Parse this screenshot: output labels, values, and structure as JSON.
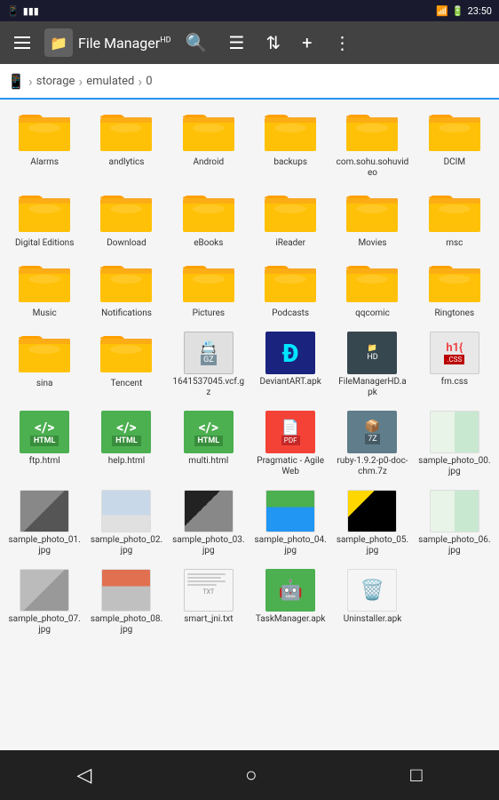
{
  "statusBar": {
    "time": "23:50",
    "icons": [
      "signal",
      "wifi",
      "battery"
    ]
  },
  "toolbar": {
    "title": "File Manager",
    "titleSup": "HD",
    "icons": [
      "search",
      "list",
      "sort",
      "add",
      "more"
    ]
  },
  "breadcrumb": {
    "items": [
      "storage",
      "emulated",
      "0"
    ]
  },
  "files": [
    {
      "name": "Alarms",
      "type": "folder"
    },
    {
      "name": "andlytics",
      "type": "folder"
    },
    {
      "name": "Android",
      "type": "folder"
    },
    {
      "name": "backups",
      "type": "folder"
    },
    {
      "name": "com.sohu.sohuvideo",
      "type": "folder"
    },
    {
      "name": "DCIM",
      "type": "folder"
    },
    {
      "name": "Digital Editions",
      "type": "folder"
    },
    {
      "name": "Download",
      "type": "folder"
    },
    {
      "name": "eBooks",
      "type": "folder"
    },
    {
      "name": "iReader",
      "type": "folder"
    },
    {
      "name": "Movies",
      "type": "folder"
    },
    {
      "name": "msc",
      "type": "folder"
    },
    {
      "name": "Music",
      "type": "folder"
    },
    {
      "name": "Notifications",
      "type": "folder"
    },
    {
      "name": "Pictures",
      "type": "folder"
    },
    {
      "name": "Podcasts",
      "type": "folder"
    },
    {
      "name": "qqcomic",
      "type": "folder"
    },
    {
      "name": "Ringtones",
      "type": "folder"
    },
    {
      "name": "sina",
      "type": "folder"
    },
    {
      "name": "Tencent",
      "type": "folder"
    },
    {
      "name": "1641537045.vcf.gz",
      "type": "vcf"
    },
    {
      "name": "DeviantART.apk",
      "type": "deviant-apk"
    },
    {
      "name": "FileManagerHD.apk",
      "type": "fm-apk"
    },
    {
      "name": "fm.css",
      "type": "css"
    },
    {
      "name": "ftp.html",
      "type": "html"
    },
    {
      "name": "help.html",
      "type": "html"
    },
    {
      "name": "multi.html",
      "type": "html"
    },
    {
      "name": "Pragmatic - Agile Web",
      "type": "pdf"
    },
    {
      "name": "ruby-1.9.2-p0-doc-chm.7z",
      "type": "7z"
    },
    {
      "name": "sample_photo_00.jpg",
      "type": "img",
      "imgClass": "img-06"
    },
    {
      "name": "sample_photo_01.jpg",
      "type": "img",
      "imgClass": "img-01"
    },
    {
      "name": "sample_photo_02.jpg",
      "type": "img",
      "imgClass": "img-02"
    },
    {
      "name": "sample_photo_03.jpg",
      "type": "img",
      "imgClass": "img-03"
    },
    {
      "name": "sample_photo_04.jpg",
      "type": "img",
      "imgClass": "img-04"
    },
    {
      "name": "sample_photo_05.jpg",
      "type": "img",
      "imgClass": "img-05"
    },
    {
      "name": "sample_photo_06.jpg",
      "type": "img",
      "imgClass": "img-06"
    },
    {
      "name": "sample_photo_07.jpg",
      "type": "img",
      "imgClass": "img-07"
    },
    {
      "name": "sample_photo_08.jpg",
      "type": "img",
      "imgClass": "img-08"
    },
    {
      "name": "smart_jni.txt",
      "type": "txt"
    },
    {
      "name": "TaskManager.apk",
      "type": "task-apk"
    },
    {
      "name": "Uninstaller.apk",
      "type": "uninstall-apk"
    }
  ],
  "bottomNav": {
    "back": "◁",
    "home": "○",
    "recent": "□"
  }
}
